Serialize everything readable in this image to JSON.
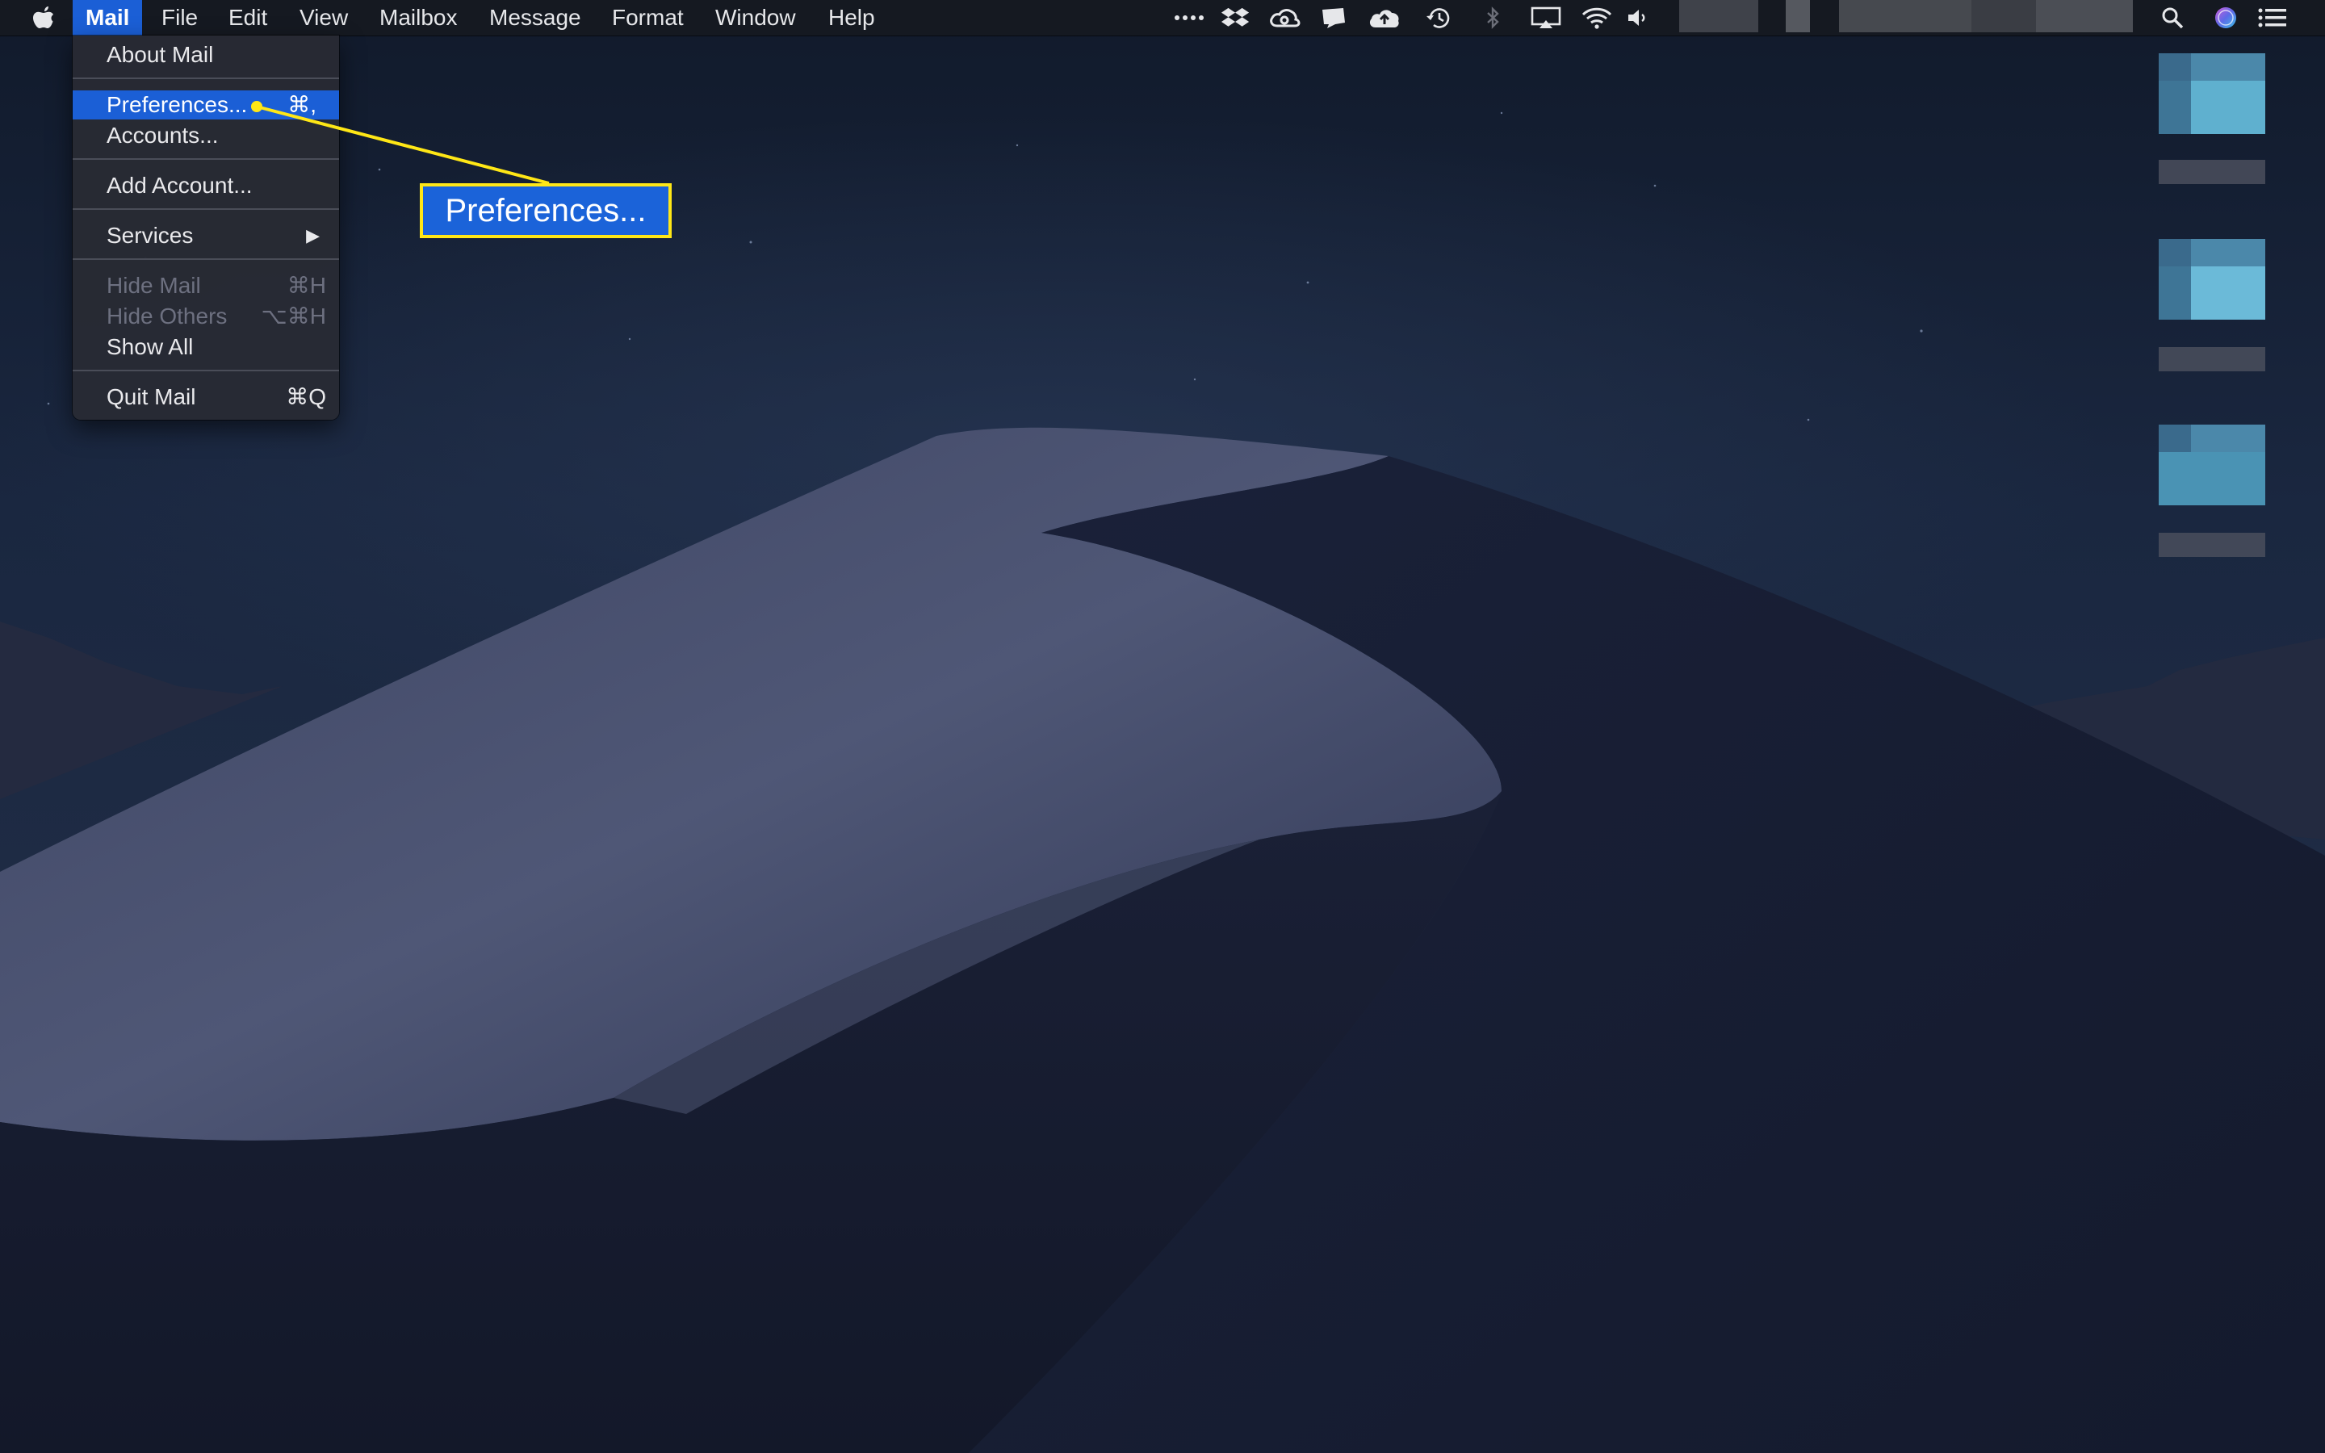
{
  "menubar": {
    "apple_icon": "apple-logo-icon",
    "menus": [
      "Mail",
      "File",
      "Edit",
      "View",
      "Mailbox",
      "Message",
      "Format",
      "Window",
      "Help"
    ],
    "active_menu": "Mail",
    "status_icons": [
      "more-dots-icon",
      "dropbox-icon",
      "creative-cloud-icon",
      "growl-icon",
      "icloud-upload-icon",
      "time-machine-icon",
      "bluetooth-icon",
      "airplay-icon",
      "wifi-icon",
      "volume-icon",
      "spotlight-icon",
      "siri-icon",
      "notification-center-icon"
    ]
  },
  "mail_menu": {
    "about": "About Mail",
    "preferences": {
      "label": "Preferences...",
      "shortcut": "⌘,"
    },
    "accounts": "Accounts...",
    "add_account": "Add Account...",
    "services": "Services",
    "hide_mail": {
      "label": "Hide Mail",
      "shortcut": "⌘H"
    },
    "hide_others": {
      "label": "Hide Others",
      "shortcut": "⌥⌘H"
    },
    "show_all": "Show All",
    "quit": {
      "label": "Quit Mail",
      "shortcut": "⌘Q"
    }
  },
  "callout": {
    "text": "Preferences...",
    "border_color": "#ffe716",
    "fill_color": "#1b63d9"
  },
  "colors": {
    "menu_highlight": "#1b5fd6",
    "menu_background": "#282a34"
  }
}
